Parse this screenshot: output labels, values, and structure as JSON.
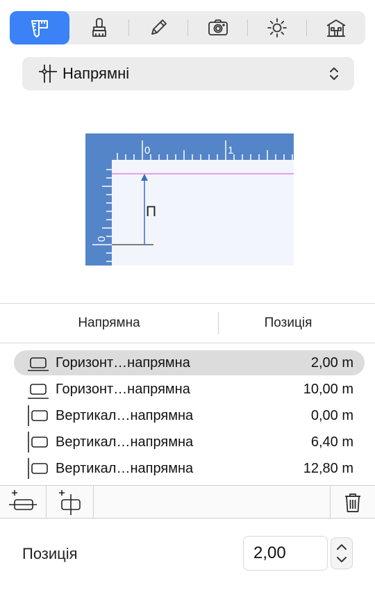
{
  "toolbar": {
    "tabs": [
      {
        "icon": "ruler-caliper-icon",
        "active": true
      },
      {
        "icon": "brush-icon",
        "active": false
      },
      {
        "icon": "pencil-icon",
        "active": false
      },
      {
        "icon": "camera-icon",
        "active": false
      },
      {
        "icon": "sun-icon",
        "active": false
      },
      {
        "icon": "house-icon",
        "active": false
      }
    ],
    "accent": "#3b82f6"
  },
  "dropdown": {
    "icon": "guides-icon",
    "label": "Напрямні"
  },
  "illustration": {
    "top_ruler_labels": [
      "0",
      "1"
    ],
    "side_ruler_label": "0",
    "marker_label": "П",
    "ruler_color": "#5585c9",
    "guide_color": "#e57ee5"
  },
  "table": {
    "columns": [
      "Напрямна",
      "Позиція"
    ],
    "rows": [
      {
        "icon": "horizontal-guide-icon",
        "name": "Горизонт…напрямна",
        "position": "2,00 m",
        "selected": true
      },
      {
        "icon": "horizontal-guide-icon",
        "name": "Горизонт…напрямна",
        "position": "10,00 m",
        "selected": false
      },
      {
        "icon": "vertical-guide-icon",
        "name": "Вертикал…напрямна",
        "position": "0,00 m",
        "selected": false
      },
      {
        "icon": "vertical-guide-icon",
        "name": "Вертикал…напрямна",
        "position": "6,40 m",
        "selected": false
      },
      {
        "icon": "vertical-guide-icon",
        "name": "Вертикал…напрямна",
        "position": "12,80 m",
        "selected": false
      }
    ]
  },
  "actions": {
    "add_horizontal": "add-horizontal-guide-icon",
    "add_vertical": "add-vertical-guide-icon",
    "delete": "trash-icon"
  },
  "position_field": {
    "label": "Позиція",
    "value": "2,00"
  }
}
